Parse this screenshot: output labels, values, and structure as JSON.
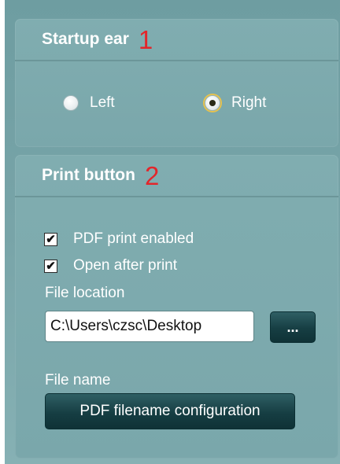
{
  "startup_ear": {
    "title": "Startup ear",
    "number": "1",
    "options": [
      {
        "label": "Left",
        "selected": false
      },
      {
        "label": "Right",
        "selected": true
      }
    ]
  },
  "print_button": {
    "title": "Print button",
    "number": "2",
    "pdf_print_enabled": {
      "label": "PDF print enabled",
      "checked": true
    },
    "open_after_print": {
      "label": "Open after print",
      "checked": true
    },
    "file_location_label": "File location",
    "file_location_value": "C:\\Users\\czsc\\Desktop",
    "browse_label": "...",
    "file_name_label": "File name",
    "config_button_label": "PDF filename configuration"
  },
  "colors": {
    "panel": "#78a4a8",
    "number_red": "#e3262b",
    "button_dark": "#163e43"
  }
}
